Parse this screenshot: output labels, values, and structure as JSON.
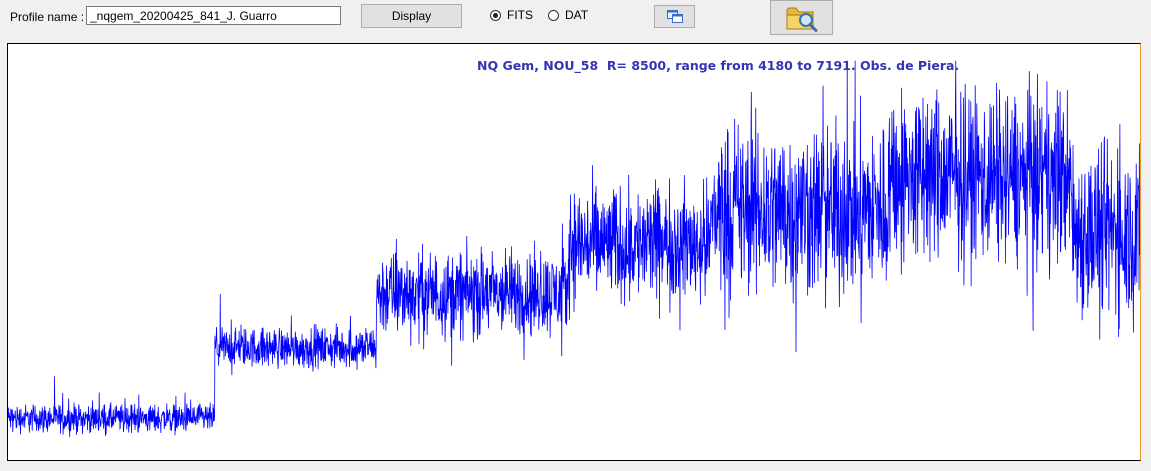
{
  "toolbar": {
    "profile_label": "Profile name :",
    "profile_value": "_nqgem_20200425_841_J. Guarro",
    "display_label": "Display",
    "fits_label": "FITS",
    "dat_label": "DAT",
    "selected_format": "FITS",
    "copy_icon": "copy-windows-icon",
    "open_icon": "folder-search-icon"
  },
  "colors": {
    "spectrum": "#0000ff",
    "title": "#3434b4",
    "right_border": "#e89a2a"
  },
  "chart_data": {
    "type": "line",
    "title": "NQ Gem, NOU_58  R= 8500, range from 4180 to 7191. Obs. de Piera.",
    "xlabel": "",
    "ylabel": "",
    "xlim": [
      4180,
      7191
    ],
    "grid": false,
    "legend": "none",
    "series": [
      {
        "color": "#0000ff",
        "segments": [
          {
            "x_start": 4180,
            "x_end": 4730,
            "mean": 0.1,
            "noise": 0.05
          },
          {
            "x_start": 4730,
            "x_end": 5160,
            "mean": 0.27,
            "noise": 0.07
          },
          {
            "x_start": 5160,
            "x_end": 5670,
            "mean": 0.4,
            "noise": 0.15
          },
          {
            "x_start": 5670,
            "x_end": 6050,
            "mean": 0.52,
            "noise": 0.2
          },
          {
            "x_start": 6050,
            "x_end": 6520,
            "mean": 0.6,
            "noise": 0.3
          },
          {
            "x_start": 6520,
            "x_end": 7010,
            "mean": 0.68,
            "noise": 0.3
          },
          {
            "x_start": 7010,
            "x_end": 7191,
            "mean": 0.55,
            "noise": 0.3
          }
        ]
      }
    ]
  }
}
